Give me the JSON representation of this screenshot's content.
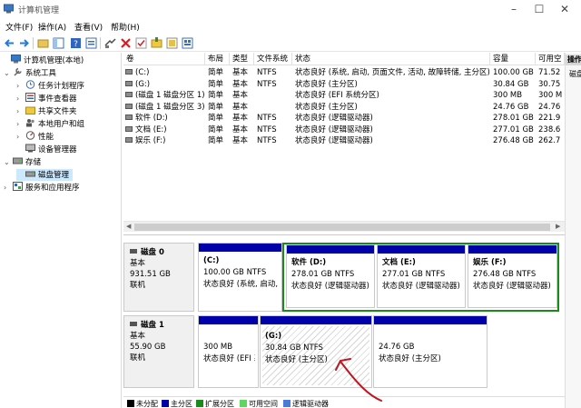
{
  "window": {
    "title": "计算机管理"
  },
  "menu": [
    "文件(F)",
    "操作(A)",
    "查看(V)",
    "帮助(H)"
  ],
  "tree": [
    {
      "label": "计算机管理(本地)",
      "level": 0,
      "chev": "",
      "icon": "computer-icon"
    },
    {
      "label": "系统工具",
      "level": 1,
      "chev": "⌄",
      "icon": "tools-icon"
    },
    {
      "label": "任务计划程序",
      "level": 2,
      "chev": "›",
      "icon": "clock-icon"
    },
    {
      "label": "事件查看器",
      "level": 2,
      "chev": "›",
      "icon": "event-icon"
    },
    {
      "label": "共享文件夹",
      "level": 2,
      "chev": "›",
      "icon": "folder-icon"
    },
    {
      "label": "本地用户和组",
      "level": 2,
      "chev": "›",
      "icon": "users-icon"
    },
    {
      "label": "性能",
      "level": 2,
      "chev": "›",
      "icon": "performance-icon"
    },
    {
      "label": "设备管理器",
      "level": 2,
      "chev": "",
      "icon": "device-icon"
    },
    {
      "label": "存储",
      "level": 1,
      "chev": "⌄",
      "icon": "storage-icon"
    },
    {
      "label": "磁盘管理",
      "level": 2,
      "chev": "",
      "icon": "disk-icon",
      "selected": true
    },
    {
      "label": "服务和应用程序",
      "level": 1,
      "chev": "›",
      "icon": "services-icon"
    }
  ],
  "volume_table": {
    "headers": [
      "卷",
      "布局",
      "类型",
      "文件系统",
      "状态",
      "容量",
      "可用空"
    ],
    "rows": [
      [
        "(C:)",
        "简单",
        "基本",
        "NTFS",
        "状态良好 (系统, 启动, 页面文件, 活动, 故障转储, 主分区)",
        "100.00 GB",
        "71.52"
      ],
      [
        "(G:)",
        "简单",
        "基本",
        "NTFS",
        "状态良好 (主分区)",
        "30.84 GB",
        "30.75"
      ],
      [
        "(磁盘 1 磁盘分区 1)",
        "简单",
        "基本",
        "",
        "状态良好 (EFI 系统分区)",
        "300 MB",
        "300 M"
      ],
      [
        "(磁盘 1 磁盘分区 3)",
        "简单",
        "基本",
        "",
        "状态良好 (主分区)",
        "24.76 GB",
        "24.76"
      ],
      [
        "软件 (D:)",
        "简单",
        "基本",
        "NTFS",
        "状态良好 (逻辑驱动器)",
        "278.01 GB",
        "221.9"
      ],
      [
        "文档 (E:)",
        "简单",
        "基本",
        "NTFS",
        "状态良好 (逻辑驱动器)",
        "277.01 GB",
        "238.6"
      ],
      [
        "娱乐 (F:)",
        "简单",
        "基本",
        "NTFS",
        "状态良好 (逻辑驱动器)",
        "276.48 GB",
        "262.7"
      ]
    ]
  },
  "disks": [
    {
      "name": "磁盘 0",
      "type": "基本",
      "size": "931.51 GB",
      "status": "联机",
      "partitions": [
        {
          "name": "(C:)",
          "size": "100.00 GB NTFS",
          "status": "状态良好 (系统, 启动,"
        },
        {
          "name": "软件 (D:)",
          "size": "278.01 GB NTFS",
          "status": "状态良好 (逻辑驱动器)"
        },
        {
          "name": "文档 (E:)",
          "size": "277.01 GB NTFS",
          "status": "状态良好 (逻辑驱动器)"
        },
        {
          "name": "娱乐 (F:)",
          "size": "276.48 GB NTFS",
          "status": "状态良好 (逻辑驱动器)"
        }
      ]
    },
    {
      "name": "磁盘 1",
      "type": "基本",
      "size": "55.90 GB",
      "status": "联机",
      "partitions": [
        {
          "name": "",
          "size": "300 MB",
          "status": "状态良好 (EFI 系"
        },
        {
          "name": "(G:)",
          "size": "30.84 GB NTFS",
          "status": "状态良好 (主分区)"
        },
        {
          "name": "",
          "size": "24.76 GB",
          "status": "状态良好 (主分区)"
        }
      ]
    }
  ],
  "legend": [
    {
      "label": "未分配",
      "color": "#000000"
    },
    {
      "label": "主分区",
      "color": "#0000a8"
    },
    {
      "label": "扩展分区",
      "color": "#1a8a1a"
    },
    {
      "label": "可用空间",
      "color": "#5fd65f"
    },
    {
      "label": "逻辑驱动器",
      "color": "#4a7bd9"
    }
  ],
  "actions": {
    "header": "操作",
    "item": "磁盘"
  },
  "colors": {
    "primary_partition": "#0000a8",
    "extended_border": "#1a8a1a",
    "selection": "#cce8ff",
    "annotation": "#c0141e"
  }
}
